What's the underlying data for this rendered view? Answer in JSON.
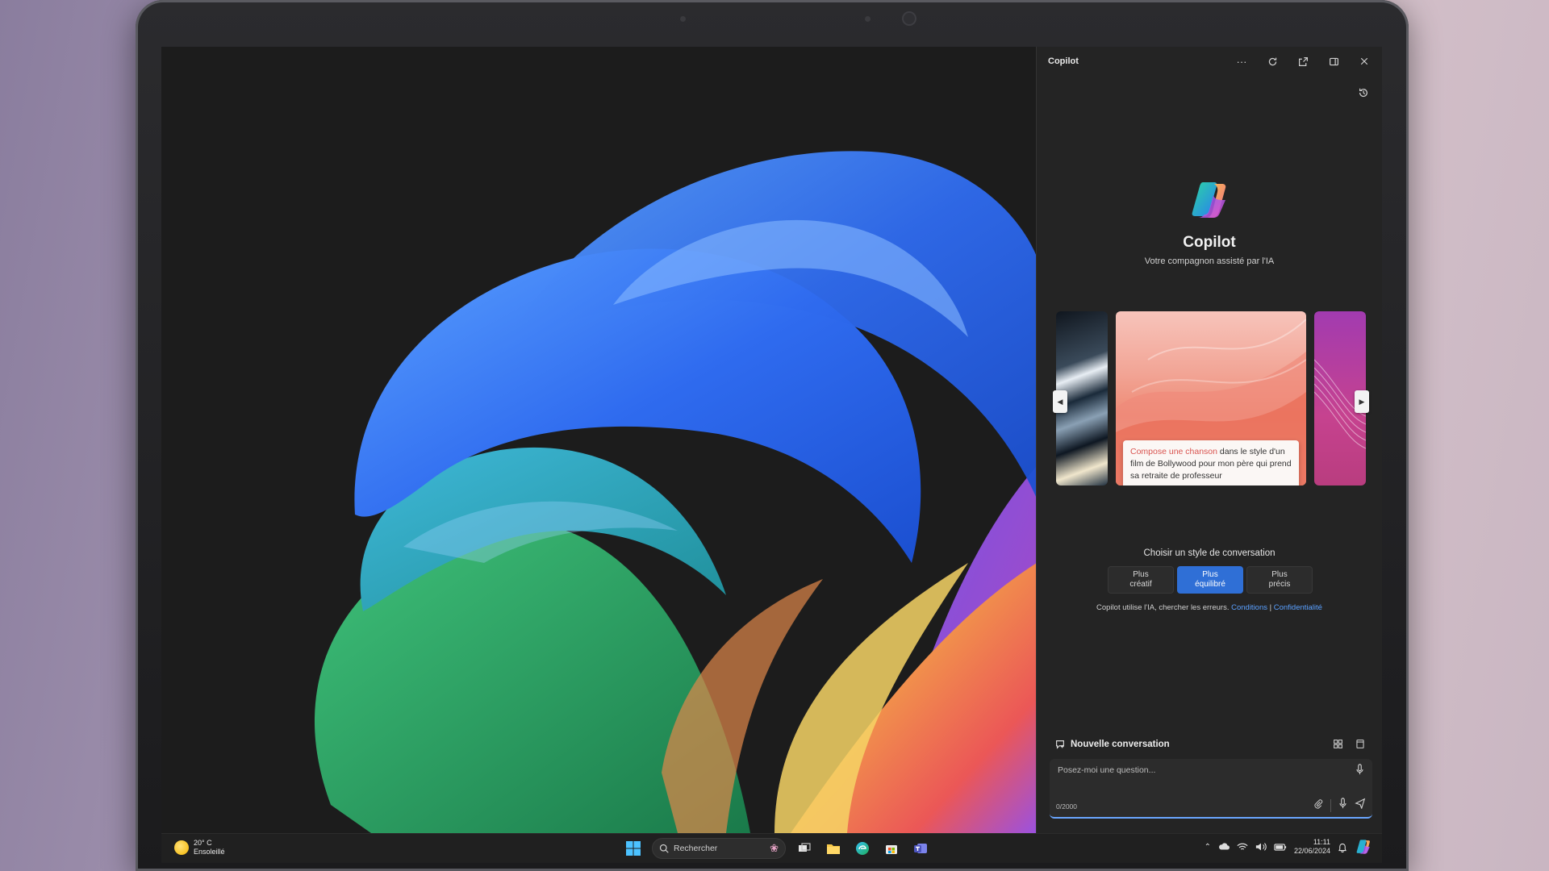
{
  "copilot": {
    "title": "Copilot",
    "window_controls": [
      "more-icon",
      "refresh-icon",
      "open-external-icon",
      "dock-icon",
      "close-icon"
    ],
    "app_name": "Copilot",
    "tagline": "Votre compagnon assisté par l'IA",
    "prompt_card": {
      "highlight": "Compose une chanson",
      "rest": " dans le style d'un film de Bollywood pour mon père qui prend sa retraite de professeur"
    },
    "style_title": "Choisir un style de conversation",
    "styles": [
      {
        "line1": "Plus",
        "line2": "créatif",
        "active": false
      },
      {
        "line1": "Plus",
        "line2": "équilibré",
        "active": true
      },
      {
        "line1": "Plus",
        "line2": "précis",
        "active": false
      }
    ],
    "disclaimer": {
      "text": "Copilot utilise l'IA, chercher les erreurs.",
      "conditions": "Conditions",
      "separator": " | ",
      "privacy": "Confidentialité"
    },
    "new_conversation": "Nouvelle conversation",
    "input": {
      "placeholder": "Posez-moi une question...",
      "counter": "0/2000"
    }
  },
  "taskbar": {
    "weather_temp": "20° C",
    "weather_desc": "Ensoleillé",
    "search_label": "Rechercher",
    "time": "11:11",
    "date": "22/06/2024"
  },
  "colors": {
    "accent": "#2f6fd6",
    "link": "#5aa0ff",
    "panel_bg": "#242424",
    "prompt_highlight": "#d9534f"
  }
}
